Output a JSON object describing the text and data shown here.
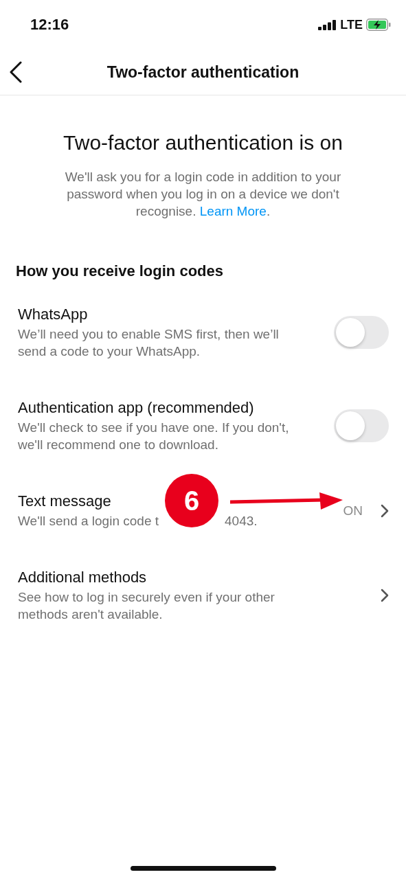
{
  "status_bar": {
    "time": "12:16",
    "network": "LTE"
  },
  "nav": {
    "title": "Two-factor authentication"
  },
  "hero": {
    "title": "Two-factor authentication is on",
    "text": "We'll ask you for a login code in addition to your password when you log in on a device we don't recognise.",
    "link": "Learn More",
    "after_link": "."
  },
  "section_title": "How you receive login codes",
  "methods": [
    {
      "kind": "toggle",
      "title": "WhatsApp",
      "description": "We’ll need you to enable SMS first, then we’ll send a code to your WhatsApp.",
      "on": false
    },
    {
      "kind": "toggle",
      "title": "Authentication app (recommended)",
      "description": "We'll check to see if you have one. If you don't, we'll recommend one to download.",
      "on": false
    },
    {
      "kind": "link",
      "title": "Text message",
      "description": "We'll send a login code t",
      "description_end": "4043.",
      "value": "ON"
    },
    {
      "kind": "link",
      "title": "Additional methods",
      "description": "See how to log in securely even if your other methods aren't available."
    }
  ],
  "annotation": {
    "number": "6"
  }
}
